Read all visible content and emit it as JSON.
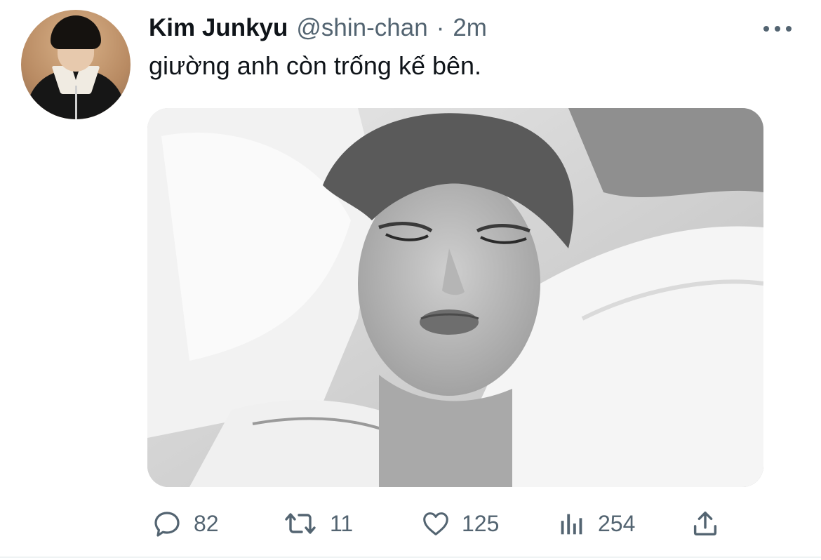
{
  "tweet": {
    "author_name": "Kim Junkyu",
    "handle": "@shin-chan",
    "separator": "·",
    "time": "2m",
    "text": "giường anh còn trống kế bên."
  },
  "actions": {
    "reply_count": "82",
    "retweet_count": "11",
    "like_count": "125",
    "views_count": "254"
  },
  "icons": {
    "more": "more-dots-icon",
    "reply": "reply-bubble-icon",
    "retweet": "retweet-arrows-icon",
    "like": "heart-icon",
    "views": "bar-chart-icon",
    "share": "share-upload-icon"
  },
  "colors": {
    "text_primary": "#0f1419",
    "text_secondary": "#536471",
    "background": "#ffffff"
  }
}
